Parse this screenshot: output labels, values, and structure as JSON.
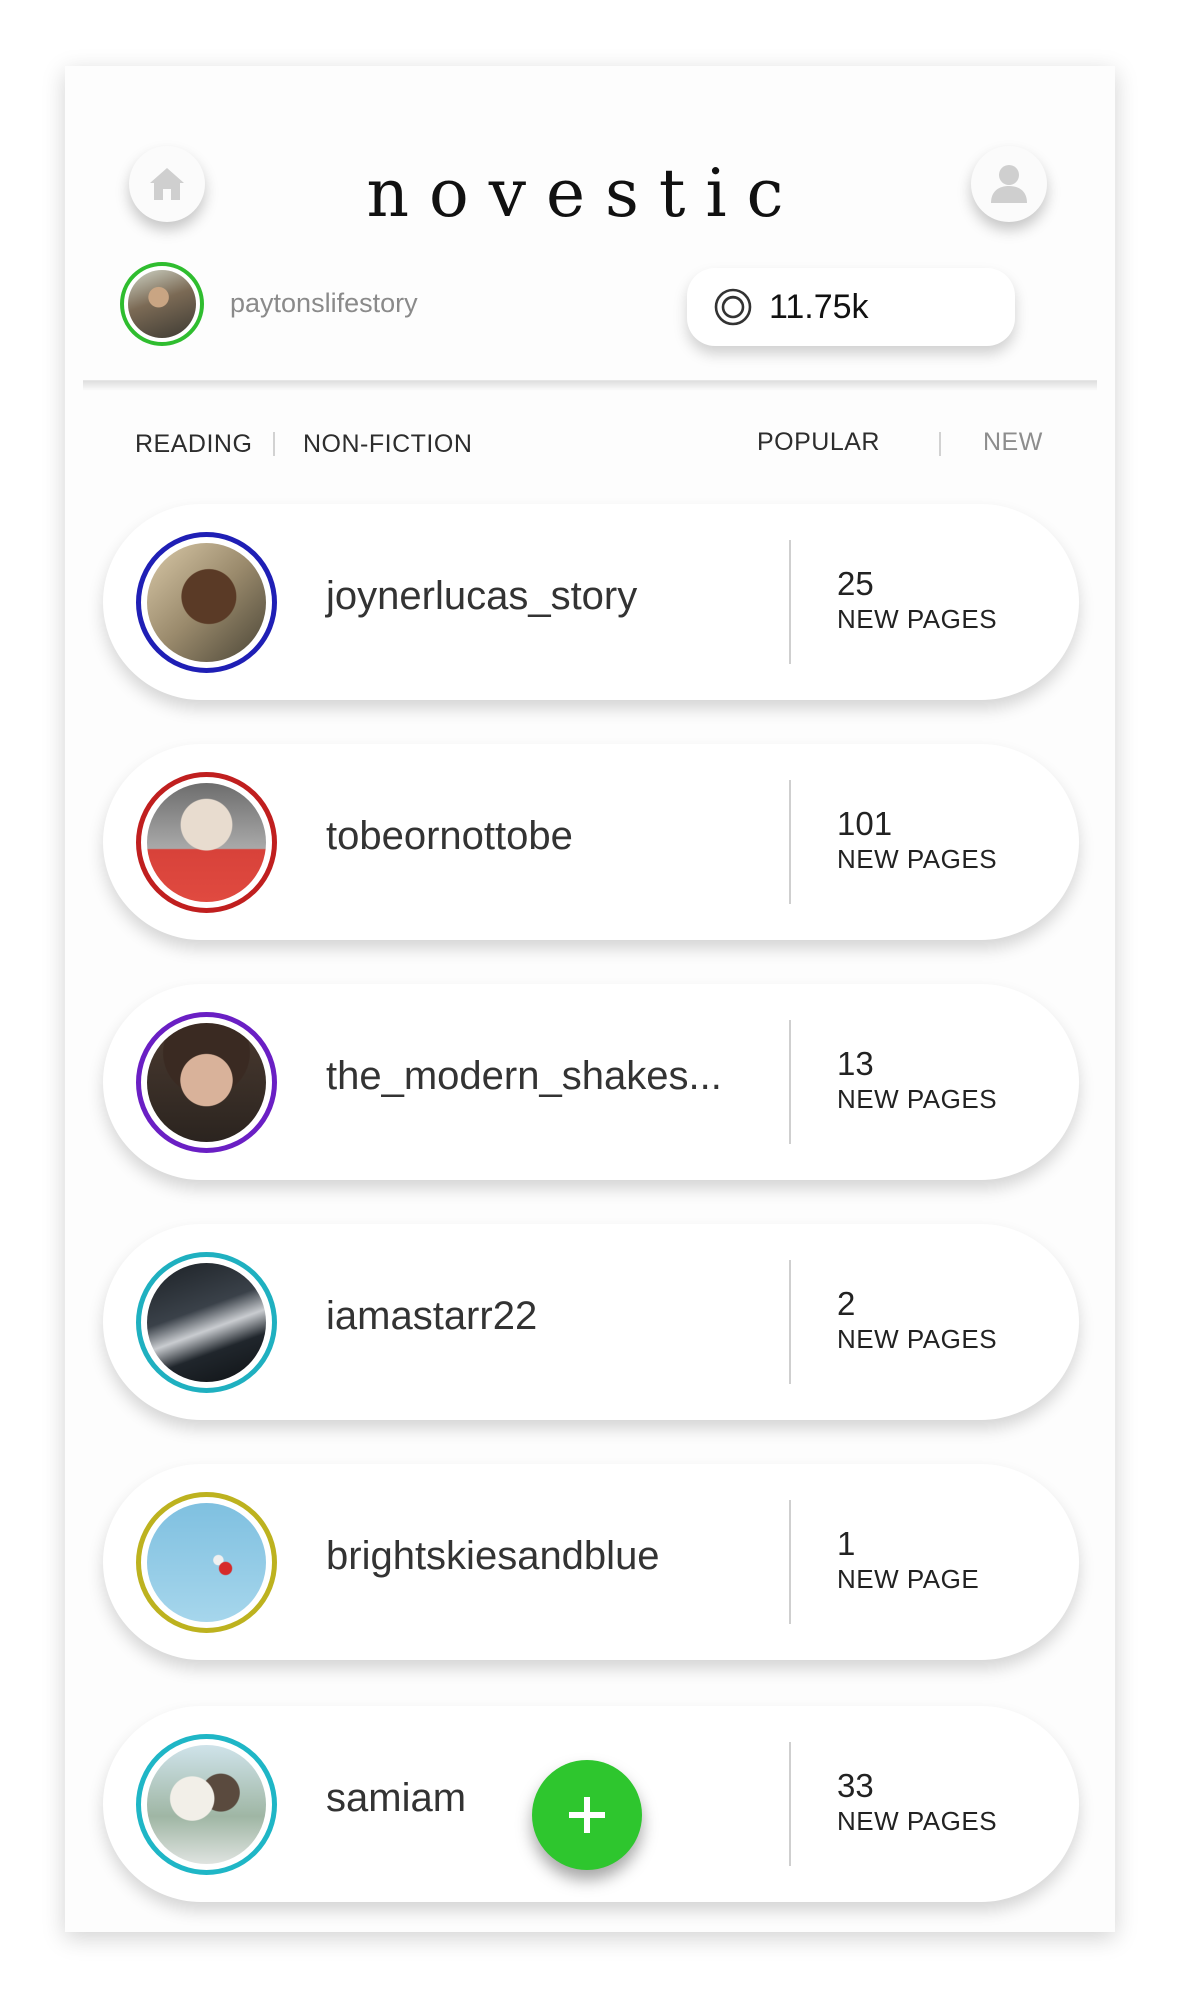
{
  "app": {
    "brand": "novestic"
  },
  "user": {
    "username": "paytonslifestory",
    "coins": "11.75k"
  },
  "filters": {
    "left": [
      "READING",
      "NON-FICTION"
    ],
    "right": [
      "POPULAR",
      "NEW"
    ]
  },
  "feed": [
    {
      "username": "joynerlucas_story",
      "count": "25",
      "label": "NEW PAGES",
      "ring_color": "#1f1fb5"
    },
    {
      "username": "tobeornottobe",
      "count": "101",
      "label": "NEW PAGES",
      "ring_color": "#c01f1f"
    },
    {
      "username": "the_modern_shakes...",
      "count": "13",
      "label": "NEW PAGES",
      "ring_color": "#6a1fc4"
    },
    {
      "username": "iamastarr22",
      "count": "2",
      "label": "NEW PAGES",
      "ring_color": "#1fb0c0"
    },
    {
      "username": "brightskiesandblue",
      "count": "1",
      "label": "NEW PAGE",
      "ring_color": "#bdb21f"
    },
    {
      "username": "samiam",
      "count": "33",
      "label": "NEW PAGES",
      "ring_color": "#1fb6c6"
    }
  ],
  "icons": {
    "home": "home-icon",
    "profile": "user-icon",
    "coins": "coin-icon",
    "add": "plus-icon"
  },
  "colors": {
    "accent_green": "#2ec62e"
  }
}
